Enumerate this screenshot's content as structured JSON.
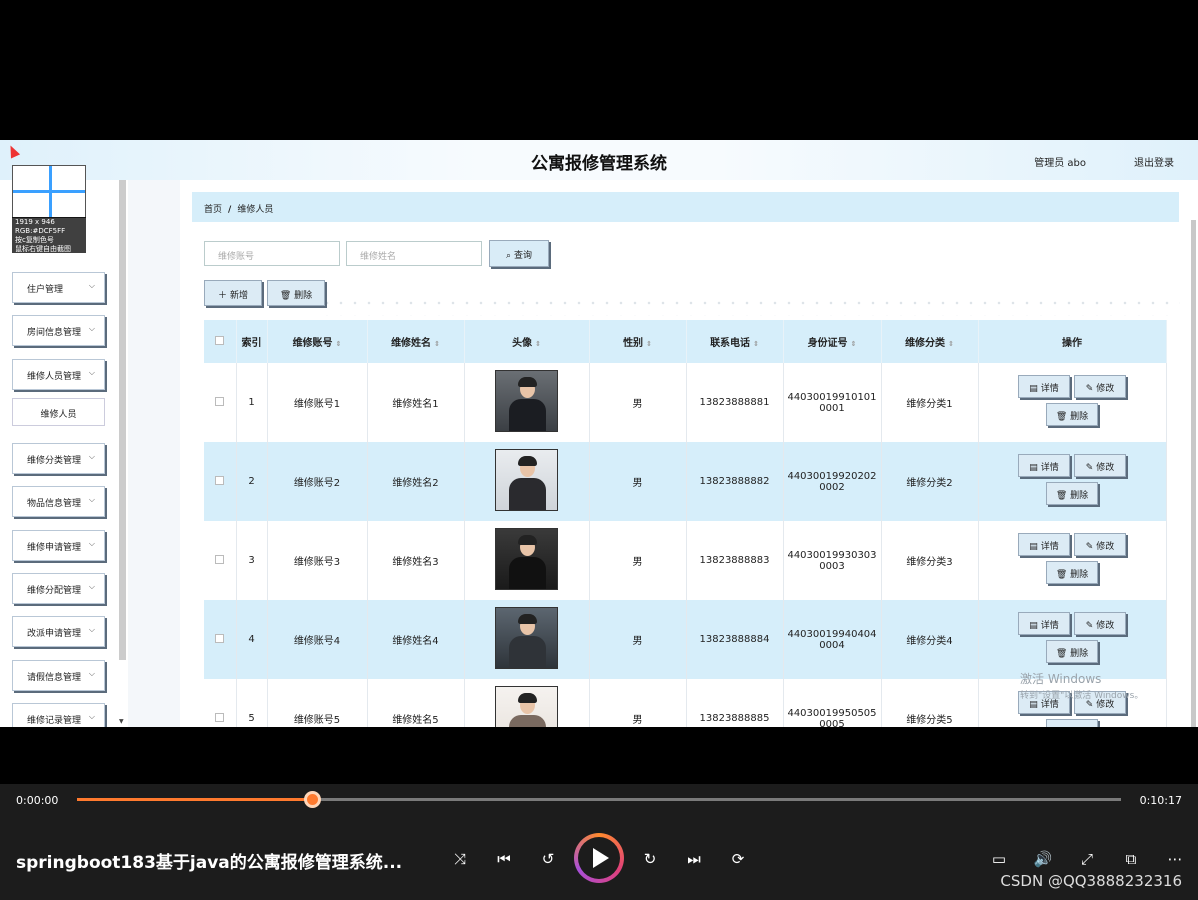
{
  "app": {
    "title": "公寓报修管理系统",
    "admin_label": "管理员 abo",
    "logout_label": "退出登录"
  },
  "capture_tool": {
    "line1": "1919 x 946",
    "line2": "RGB:#DCF5FF",
    "line3": "按c复制色号",
    "line4": "鼠标右键自由截图"
  },
  "sidebar": {
    "items": [
      {
        "label": "住户管理"
      },
      {
        "label": "房间信息管理"
      },
      {
        "label": "维修人员管理"
      },
      {
        "label": "维修人员"
      },
      {
        "label": "维修分类管理"
      },
      {
        "label": "物品信息管理"
      },
      {
        "label": "维修申请管理"
      },
      {
        "label": "维修分配管理"
      },
      {
        "label": "改派申请管理"
      },
      {
        "label": "请假信息管理"
      },
      {
        "label": "维修记录管理"
      }
    ]
  },
  "breadcrumb": {
    "home": "首页",
    "separator": "/",
    "current": "维修人员"
  },
  "search": {
    "account_placeholder": "维修账号",
    "name_placeholder": "维修姓名",
    "query_label": "查询"
  },
  "toolbar": {
    "add_label": "新增",
    "delete_label": "删除"
  },
  "table": {
    "headers": {
      "index": "索引",
      "account": "维修账号",
      "name": "维修姓名",
      "avatar": "头像",
      "gender": "性别",
      "phone": "联系电话",
      "id_number": "身份证号",
      "category": "维修分类",
      "actions": "操作"
    },
    "action_labels": {
      "detail": "详情",
      "edit": "修改",
      "delete": "删除"
    },
    "rows": [
      {
        "index": "1",
        "account": "维修账号1",
        "name": "维修姓名1",
        "gender": "男",
        "phone": "13823888881",
        "id_a": "44030019910101",
        "id_b": "0001",
        "category": "维修分类1"
      },
      {
        "index": "2",
        "account": "维修账号2",
        "name": "维修姓名2",
        "gender": "男",
        "phone": "13823888882",
        "id_a": "44030019920202",
        "id_b": "0002",
        "category": "维修分类2"
      },
      {
        "index": "3",
        "account": "维修账号3",
        "name": "维修姓名3",
        "gender": "男",
        "phone": "13823888883",
        "id_a": "44030019930303",
        "id_b": "0003",
        "category": "维修分类3"
      },
      {
        "index": "4",
        "account": "维修账号4",
        "name": "维修姓名4",
        "gender": "男",
        "phone": "13823888884",
        "id_a": "44030019940404",
        "id_b": "0004",
        "category": "维修分类4"
      },
      {
        "index": "5",
        "account": "维修账号5",
        "name": "维修姓名5",
        "gender": "男",
        "phone": "13823888885",
        "id_a": "44030019950505",
        "id_b": "0005",
        "category": "维修分类5"
      }
    ]
  },
  "watermark": {
    "line1": "激活 Windows",
    "line2": "转到\"设置\"以激活 Windows。"
  },
  "player": {
    "time_current": "0:00:00",
    "time_total": "0:10:17",
    "progress": 0.225,
    "video_title": "springboot183基于java的公寓报修管理系统...",
    "credit": "CSDN @QQ3888232316",
    "accent_color": "#ff7a2e"
  }
}
